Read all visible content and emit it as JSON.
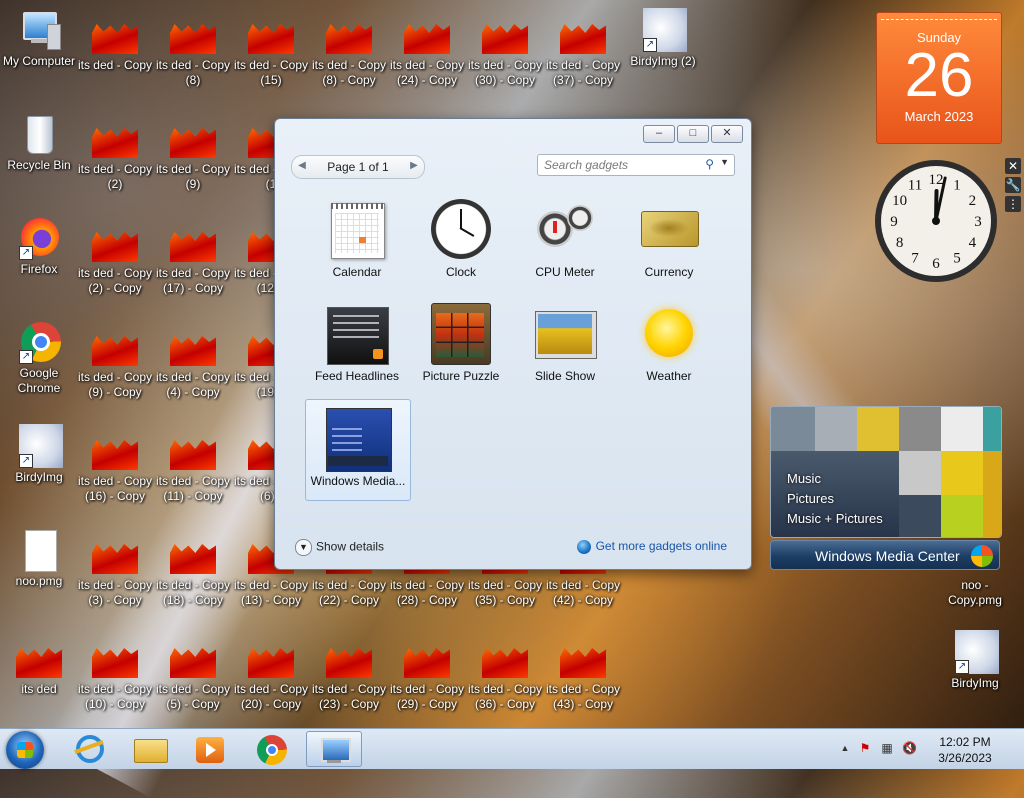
{
  "desktop": {
    "icons_left": [
      {
        "label": "My Computer"
      },
      {
        "label": "Recycle Bin"
      },
      {
        "label": "Firefox"
      },
      {
        "label": "Google Chrome"
      },
      {
        "label": "BirdyImg"
      },
      {
        "label": "noo.pmg"
      },
      {
        "label": "its ded"
      }
    ],
    "its_ded_grid": [
      [
        "its ded - Copy",
        "its ded - Copy (8)",
        "its ded - Copy (15)",
        "its ded - Copy (8) - Copy",
        "its ded - Copy (24) - Copy",
        "its ded - Copy (30) - Copy",
        "its ded - Copy (37) - Copy"
      ],
      [
        "its ded - Copy (2)",
        "its ded - Copy (9)",
        "its ded - Copy (1"
      ],
      [
        "its ded - Copy (2) - Copy",
        "its ded - Copy (17) - Copy",
        "its ded - Copy (12) -"
      ],
      [
        "its ded - Copy (9) - Copy",
        "its ded - Copy (4) - Copy",
        "its ded - Copy (19) -"
      ],
      [
        "its ded - Copy (16) - Copy",
        "its ded - Copy (11) - Copy",
        "its ded - Copy (6) -"
      ],
      [
        "its ded - Copy (3) - Copy",
        "its ded - Copy (18) - Copy",
        "its ded - Copy (13) - Copy",
        "its ded - Copy (22) - Copy",
        "its ded - Copy (28) - Copy",
        "its ded - Copy (35) - Copy",
        "its ded - Copy (42) - Copy"
      ],
      [
        "its ded - Copy (10) - Copy",
        "its ded - Copy (5) - Copy",
        "its ded - Copy (20) - Copy",
        "its ded - Copy (23) - Copy",
        "its ded - Copy (29) - Copy",
        "its ded - Copy (36) - Copy",
        "its ded - Copy (43) - Copy"
      ]
    ],
    "icons_right": [
      {
        "label": "BirdyImg (2)"
      },
      {
        "label": "noo - Copy.pmg"
      },
      {
        "label": "BirdyImg"
      }
    ]
  },
  "gadgets_window": {
    "pager": {
      "text": "Page 1 of 1",
      "prev": "◀",
      "next": "▶"
    },
    "search": {
      "placeholder": "Search gadgets"
    },
    "gadgets": [
      {
        "label": "Calendar"
      },
      {
        "label": "Clock"
      },
      {
        "label": "CPU Meter"
      },
      {
        "label": "Currency"
      },
      {
        "label": "Feed Headlines"
      },
      {
        "label": "Picture Puzzle"
      },
      {
        "label": "Slide Show"
      },
      {
        "label": "Weather"
      },
      {
        "label": "Windows Media...",
        "selected": true
      }
    ],
    "footer": {
      "show_details": "Show details",
      "get_more": "Get more gadgets online"
    },
    "title_buttons": {
      "minimize": "–",
      "maximize": "□",
      "close": "✕"
    }
  },
  "calendar_gadget": {
    "weekday": "Sunday",
    "day": "26",
    "month_year": "March 2023"
  },
  "clock_gadget": {
    "numbers": [
      "12",
      "1",
      "2",
      "3",
      "4",
      "5",
      "6",
      "7",
      "8",
      "9",
      "10",
      "11"
    ],
    "hours": 0,
    "minutes": 2
  },
  "gadget_side_buttons": {
    "close": "✕",
    "options": "🔧",
    "drag": "⋮"
  },
  "media_center_gadget": {
    "items": [
      "Music",
      "Pictures",
      "Music + Pictures"
    ],
    "title": "Windows Media Center"
  },
  "taskbar": {
    "clock_time": "12:02 PM",
    "clock_date": "3/26/2023",
    "tray_up_arrow": "▲"
  },
  "colors": {
    "accent": "#1a56a8",
    "calendar_orange": "#e8541a"
  }
}
